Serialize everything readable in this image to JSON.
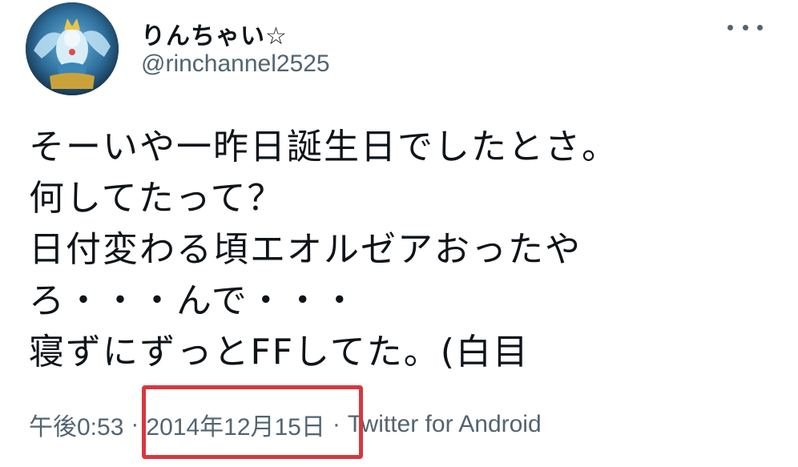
{
  "user": {
    "display_name": "りんちゃい☆",
    "handle": "@rinchannel2525"
  },
  "tweet": {
    "lines": [
      "そーいや一昨日誕生日でしたとさ。",
      "何してたって？",
      "日付変わる頃エオルゼアおったや",
      "ろ・・・んで・・・",
      "寝ずにずっとFFしてた。(白目"
    ]
  },
  "meta": {
    "time": "午後0:53",
    "separator": "·",
    "date": "2014年12月15日",
    "source": "Twitter for Android"
  },
  "icons": {
    "more": "more-horizontal-icon",
    "avatar": "avatar-image"
  },
  "colors": {
    "text_primary": "#0f1419",
    "text_secondary": "#536471",
    "highlight": "#d9363e"
  }
}
